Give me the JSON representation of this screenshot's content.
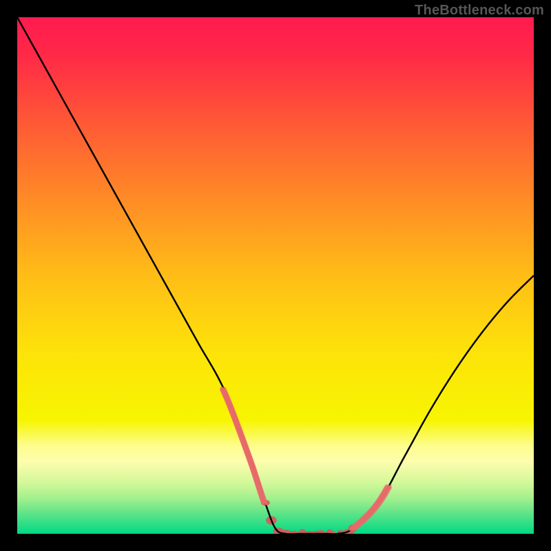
{
  "attribution": "TheBottleneck.com",
  "chart_data": {
    "type": "line",
    "title": "",
    "xlabel": "",
    "ylabel": "",
    "xlim": [
      0,
      100
    ],
    "ylim": [
      0,
      100
    ],
    "series": [
      {
        "name": "curve",
        "x": [
          0,
          5,
          10,
          15,
          20,
          25,
          30,
          35,
          40,
          45,
          48,
          50,
          52,
          55,
          58,
          60,
          62,
          65,
          70,
          75,
          80,
          85,
          90,
          95,
          100
        ],
        "y": [
          100,
          91,
          82,
          73,
          64,
          55,
          46,
          37,
          28,
          15,
          6,
          1,
          0,
          0,
          0,
          0,
          0,
          1,
          6,
          15,
          24,
          32,
          39,
          45,
          50
        ]
      }
    ],
    "highlight_ranges": [
      {
        "x_start": 40,
        "x_end": 48
      },
      {
        "x_start": 65,
        "x_end": 72
      }
    ],
    "dot_segments": [
      {
        "x_start": 48,
        "x_end": 65
      }
    ],
    "background_gradient_stops": [
      {
        "offset": 0.0,
        "color": "#ff1a4f"
      },
      {
        "offset": 0.07,
        "color": "#ff2847"
      },
      {
        "offset": 0.2,
        "color": "#ff5736"
      },
      {
        "offset": 0.35,
        "color": "#ff8a26"
      },
      {
        "offset": 0.5,
        "color": "#ffbd17"
      },
      {
        "offset": 0.65,
        "color": "#fde309"
      },
      {
        "offset": 0.78,
        "color": "#f7f501"
      },
      {
        "offset": 0.83,
        "color": "#fdfd8f"
      },
      {
        "offset": 0.86,
        "color": "#fdfdad"
      },
      {
        "offset": 0.9,
        "color": "#d4f89a"
      },
      {
        "offset": 0.93,
        "color": "#a6f08e"
      },
      {
        "offset": 0.96,
        "color": "#60e488"
      },
      {
        "offset": 1.0,
        "color": "#00d985"
      }
    ],
    "curve_stroke": "#000000",
    "highlight_stroke": "#e86a6a",
    "dot_color": "#d85858"
  }
}
